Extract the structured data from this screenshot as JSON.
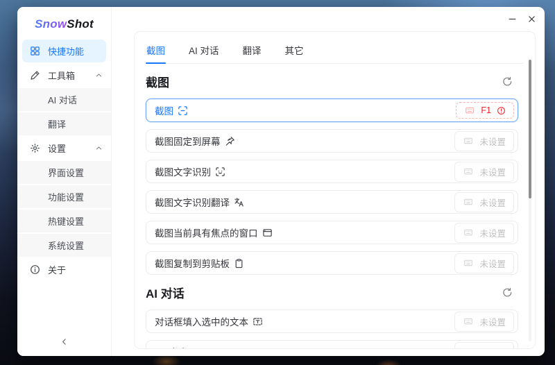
{
  "brand": {
    "first": "Snow",
    "second": "Shot"
  },
  "sidebar": {
    "items": [
      {
        "id": "quick-functions",
        "label": "快捷功能",
        "icon": "grid",
        "selected": true
      },
      {
        "id": "toolbox",
        "label": "工具箱",
        "icon": "pen",
        "expandable": true
      },
      {
        "id": "ai-chat",
        "label": "AI 对话",
        "child": true
      },
      {
        "id": "translate",
        "label": "翻译",
        "child": true
      },
      {
        "id": "settings",
        "label": "设置",
        "icon": "gear",
        "expandable": true
      },
      {
        "id": "ui-settings",
        "label": "界面设置",
        "child": true
      },
      {
        "id": "function-settings",
        "label": "功能设置",
        "child": true
      },
      {
        "id": "hotkey-settings",
        "label": "热键设置",
        "child": true
      },
      {
        "id": "system-settings",
        "label": "系统设置",
        "child": true
      },
      {
        "id": "about",
        "label": "关于",
        "icon": "info"
      }
    ]
  },
  "tabs": [
    {
      "id": "screenshot",
      "label": "截图",
      "active": true
    },
    {
      "id": "ai-chat",
      "label": "AI 对话"
    },
    {
      "id": "translate",
      "label": "翻译"
    },
    {
      "id": "other",
      "label": "其它"
    }
  ],
  "sections": [
    {
      "id": "screenshot",
      "title": "截图",
      "rows": [
        {
          "id": "screenshot",
          "label": "截图",
          "icon": "crop",
          "selected": true,
          "hotkey": {
            "key": "F1",
            "status": "error"
          }
        },
        {
          "id": "pin-to-screen",
          "label": "截图固定到屏幕",
          "icon": "pin",
          "hotkey": {
            "key": "未设置",
            "status": "unset"
          }
        },
        {
          "id": "ocr",
          "label": "截图文字识别",
          "icon": "ocr",
          "hotkey": {
            "key": "未设置",
            "status": "unset"
          }
        },
        {
          "id": "ocr-translate",
          "label": "截图文字识别翻译",
          "icon": "translate",
          "hotkey": {
            "key": "未设置",
            "status": "unset"
          }
        },
        {
          "id": "capture-focused-window",
          "label": "截图当前具有焦点的窗口",
          "icon": "window",
          "hotkey": {
            "key": "未设置",
            "status": "unset"
          }
        },
        {
          "id": "copy-to-clipboard",
          "label": "截图复制到剪贴板",
          "icon": "clipboard",
          "hotkey": {
            "key": "未设置",
            "status": "unset"
          }
        }
      ]
    },
    {
      "id": "ai-chat",
      "title": "AI 对话",
      "rows": [
        {
          "id": "fill-selected-text",
          "label": "对话框填入选中的文本",
          "icon": "text-select",
          "hotkey": {
            "key": "未设置",
            "status": "unset"
          }
        },
        {
          "id": "ai-chat",
          "label": "AI 对话",
          "icon": "chat",
          "hotkey": {
            "key": "未设置",
            "status": "unset"
          }
        }
      ]
    }
  ],
  "colors": {
    "accent": "#1677ff",
    "accent_bg": "#e6f4ff",
    "error": "#f5222d",
    "error_border": "#ffb4b4",
    "muted": "#bfbfbf"
  }
}
